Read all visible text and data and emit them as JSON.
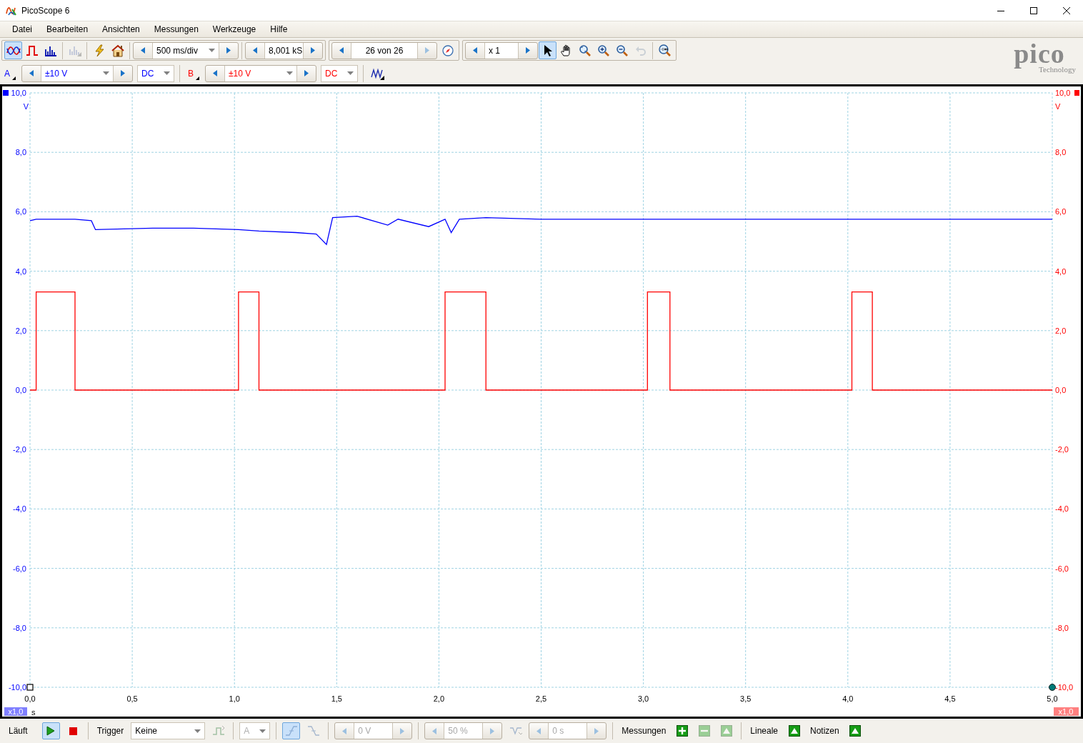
{
  "window": {
    "title": "PicoScope 6"
  },
  "menu": [
    "Datei",
    "Bearbeiten",
    "Ansichten",
    "Messungen",
    "Werkzeuge",
    "Hilfe"
  ],
  "toolbar": {
    "view_modes": [
      {
        "kind": "scope",
        "selected": true
      },
      {
        "kind": "persistence",
        "selected": false
      },
      {
        "kind": "spectrum",
        "selected": false
      }
    ],
    "secondary_view": {
      "disabled": true
    },
    "timebase": {
      "value": "500 ms/div"
    },
    "samples": {
      "value": "8,001 kS"
    },
    "buffer": {
      "value": "26 von 26"
    },
    "zoom": {
      "value": "x 1"
    },
    "tools": [
      {
        "kind": "pointer",
        "selected": true,
        "disabled": false
      },
      {
        "kind": "hand",
        "selected": false,
        "disabled": false
      },
      {
        "kind": "zoom-box",
        "selected": false,
        "disabled": false
      },
      {
        "kind": "zoom-in",
        "selected": false,
        "disabled": false
      },
      {
        "kind": "zoom-out",
        "selected": false,
        "disabled": false
      },
      {
        "kind": "undo",
        "selected": false,
        "disabled": true
      }
    ]
  },
  "logo": {
    "wordmark": "pico",
    "tagline": "Technology"
  },
  "channels": [
    {
      "label": "A",
      "color": "#0000ff",
      "range": {
        "value": "±10 V"
      },
      "coupling": {
        "value": "DC"
      }
    },
    {
      "label": "B",
      "color": "#ff0000",
      "range": {
        "value": "±10 V"
      },
      "coupling": {
        "value": "DC"
      }
    }
  ],
  "scope": {
    "chart_data": {
      "type": "line",
      "xlabel": "s",
      "ylabel": "V",
      "x": [
        0,
        0.03,
        0.03,
        0.22,
        0.22,
        0.3,
        0.32,
        0.6,
        0.8,
        1.02,
        1.02,
        1.12,
        1.12,
        1.3,
        1.4,
        1.45,
        1.48,
        1.6,
        1.75,
        1.8,
        1.95,
        2.03,
        2.03,
        2.06,
        2.1,
        2.23,
        2.23,
        2.5,
        3.02,
        3.02,
        3.13,
        3.13,
        3.5,
        4.02,
        4.02,
        4.12,
        4.12,
        4.5,
        5.0
      ],
      "grid": true,
      "series": [
        {
          "color": "#0000ff",
          "values": [
            5.7,
            5.75,
            5.75,
            5.75,
            5.75,
            5.7,
            5.4,
            5.45,
            5.45,
            5.4,
            5.4,
            5.35,
            5.35,
            5.3,
            5.25,
            4.9,
            5.8,
            5.85,
            5.55,
            5.75,
            5.5,
            5.75,
            5.75,
            5.3,
            5.75,
            5.8,
            5.8,
            5.75,
            5.75,
            5.75,
            5.75,
            5.75,
            5.75,
            5.75,
            5.75,
            5.75,
            5.75,
            5.75,
            5.75
          ]
        },
        {
          "color": "#ff0000",
          "values": [
            0,
            0,
            3.3,
            3.3,
            0,
            0,
            0,
            0,
            0,
            0,
            3.3,
            3.3,
            0,
            0,
            0,
            0,
            0,
            0,
            0,
            0,
            0,
            0,
            3.3,
            3.3,
            3.3,
            3.3,
            0,
            0,
            0,
            3.3,
            3.3,
            0,
            0,
            0,
            3.3,
            3.3,
            0,
            0,
            0
          ]
        }
      ],
      "xlim": [
        0,
        5
      ],
      "ylim": [
        -10,
        10
      ],
      "xticks": [
        {
          "value": 0,
          "label": "0,0"
        },
        {
          "value": 0.5,
          "label": "0,5"
        },
        {
          "value": 1,
          "label": "1,0"
        },
        {
          "value": 1.5,
          "label": "1,5"
        },
        {
          "value": 2,
          "label": "2,0"
        },
        {
          "value": 2.5,
          "label": "2,5"
        },
        {
          "value": 3,
          "label": "3,0"
        },
        {
          "value": 3.5,
          "label": "3,5"
        },
        {
          "value": 4,
          "label": "4,0"
        },
        {
          "value": 4.5,
          "label": "4,5"
        },
        {
          "value": 5,
          "label": "5,0"
        }
      ],
      "yticks": [
        {
          "value": 10,
          "label": "10,0"
        },
        {
          "value": 8,
          "label": "8,0"
        },
        {
          "value": 6,
          "label": "6,0"
        },
        {
          "value": 4,
          "label": "4,0"
        },
        {
          "value": 2,
          "label": "2,0"
        },
        {
          "value": 0,
          "label": "0,0"
        },
        {
          "value": -2,
          "label": "-2,0"
        },
        {
          "value": -4,
          "label": "-4,0"
        },
        {
          "value": -6,
          "label": "-6,0"
        },
        {
          "value": -8,
          "label": "-8,0"
        },
        {
          "value": -10,
          "label": "-10,0"
        }
      ]
    },
    "right_axis": {
      "unit": "V",
      "labels": [
        "10,0",
        "8,0",
        "6,0",
        "4,0",
        "2,0",
        "0,0",
        "-2,0",
        "-4,0",
        "-6,0",
        "-8,0",
        "-10,0"
      ]
    },
    "left_scale": "x1,0",
    "right_scale": "x1,0"
  },
  "status_bar": {
    "run": {
      "label": "Läuft",
      "running": true
    },
    "trigger": {
      "label": "Trigger",
      "mode": {
        "value": "Keine"
      },
      "source": {
        "value": "A",
        "disabled": true
      },
      "threshold": {
        "value": "0 V",
        "disabled": true
      },
      "pretrigger": {
        "value": "50 %",
        "disabled": true
      },
      "delay": {
        "value": "0 s",
        "disabled": true
      }
    },
    "measurements": {
      "label": "Messungen",
      "buttons": [
        {
          "kind": "add",
          "disabled": false
        },
        {
          "kind": "remove",
          "disabled": true
        },
        {
          "kind": "expand",
          "disabled": true
        }
      ]
    },
    "rulers": {
      "label": "Lineale"
    },
    "notes": {
      "label": "Notizen"
    }
  }
}
